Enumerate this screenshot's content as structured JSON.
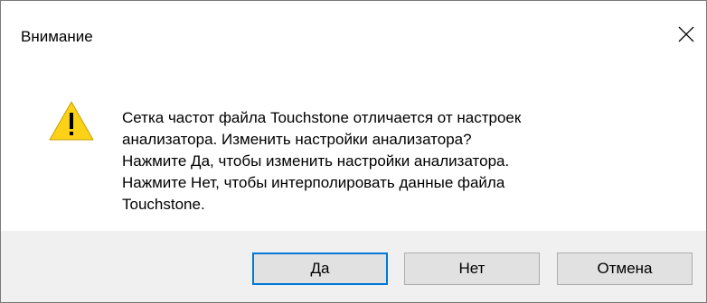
{
  "window": {
    "title": "Внимание",
    "close_icon": "close-icon"
  },
  "message": {
    "icon": "warning-icon",
    "lines": [
      "Сетка частот файла Touchstone отличается от настроек",
      "анализатора. Изменить настройки анализатора?",
      "Нажмите Да, чтобы изменить настройки анализатора.",
      "Нажмите Нет, чтобы интерполировать данные файла",
      "Touchstone."
    ]
  },
  "buttons": {
    "yes": "Да",
    "no": "Нет",
    "cancel": "Отмена"
  },
  "colors": {
    "warning_fill": "#fcd116",
    "focus_border": "#0078d7",
    "footer_bg": "#f0f0f0"
  }
}
